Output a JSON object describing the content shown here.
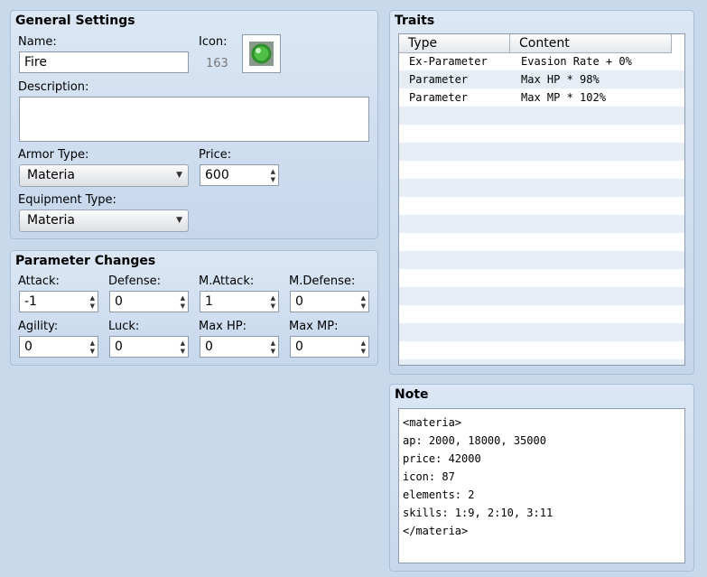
{
  "general": {
    "title": "General Settings",
    "name_label": "Name:",
    "name_value": "Fire",
    "icon_label": "Icon:",
    "icon_index": "163",
    "description_label": "Description:",
    "description_value": "",
    "armor_type_label": "Armor Type:",
    "armor_type_value": "Materia",
    "price_label": "Price:",
    "price_value": "600",
    "equip_type_label": "Equipment Type:",
    "equip_type_value": "Materia"
  },
  "params": {
    "title": "Parameter Changes",
    "fields": [
      {
        "label": "Attack:",
        "value": "-1"
      },
      {
        "label": "Defense:",
        "value": "0"
      },
      {
        "label": "M.Attack:",
        "value": "1"
      },
      {
        "label": "M.Defense:",
        "value": "0"
      },
      {
        "label": "Agility:",
        "value": "0"
      },
      {
        "label": "Luck:",
        "value": "0"
      },
      {
        "label": "Max HP:",
        "value": "0"
      },
      {
        "label": "Max MP:",
        "value": "0"
      }
    ]
  },
  "traits": {
    "title": "Traits",
    "columns": [
      "Type",
      "Content"
    ],
    "rows": [
      {
        "type": "Ex-Parameter",
        "content": "Evasion Rate + 0%"
      },
      {
        "type": "Parameter",
        "content": "Max HP * 98%"
      },
      {
        "type": "Parameter",
        "content": "Max MP * 102%"
      }
    ]
  },
  "note": {
    "title": "Note",
    "lines": [
      "<materia>",
      "ap: 2000, 18000, 35000",
      "price: 42000",
      "icon: 87",
      "elements: 2",
      "skills: 1:9, 2:10, 3:11",
      "</materia>"
    ]
  },
  "colors": {
    "panel": "#c6d7ec",
    "background": "#c9d9ec",
    "row_alt": "#e6edf4",
    "icon_green": "#3fa33a"
  }
}
